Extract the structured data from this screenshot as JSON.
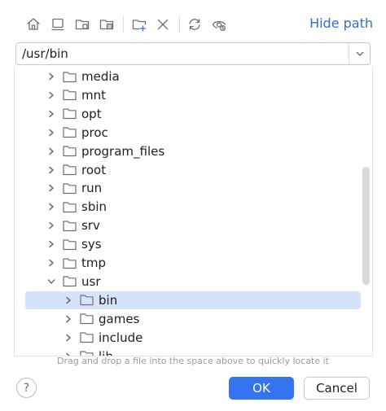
{
  "toolbar": {
    "buttons": [
      {
        "icon": "home-icon"
      },
      {
        "icon": "desktop-icon"
      },
      {
        "icon": "project-folder-icon"
      },
      {
        "icon": "module-folder-icon"
      },
      {
        "icon": "new-folder-icon"
      },
      {
        "icon": "delete-icon"
      },
      {
        "icon": "refresh-icon"
      },
      {
        "icon": "show-hidden-icon"
      }
    ],
    "hide_path_label": "Hide path"
  },
  "path": {
    "value": "/usr/bin"
  },
  "tree": {
    "items": [
      {
        "label": "media",
        "expanded": false,
        "selected": false,
        "level": 0
      },
      {
        "label": "mnt",
        "expanded": false,
        "selected": false,
        "level": 0
      },
      {
        "label": "opt",
        "expanded": false,
        "selected": false,
        "level": 0
      },
      {
        "label": "proc",
        "expanded": false,
        "selected": false,
        "level": 0
      },
      {
        "label": "program_files",
        "expanded": false,
        "selected": false,
        "level": 0
      },
      {
        "label": "root",
        "expanded": false,
        "selected": false,
        "level": 0
      },
      {
        "label": "run",
        "expanded": false,
        "selected": false,
        "level": 0
      },
      {
        "label": "sbin",
        "expanded": false,
        "selected": false,
        "level": 0
      },
      {
        "label": "srv",
        "expanded": false,
        "selected": false,
        "level": 0
      },
      {
        "label": "sys",
        "expanded": false,
        "selected": false,
        "level": 0
      },
      {
        "label": "tmp",
        "expanded": false,
        "selected": false,
        "level": 0
      },
      {
        "label": "usr",
        "expanded": true,
        "selected": false,
        "level": 0
      },
      {
        "label": "bin",
        "expanded": false,
        "selected": true,
        "level": 1
      },
      {
        "label": "games",
        "expanded": false,
        "selected": false,
        "level": 1
      },
      {
        "label": "include",
        "expanded": false,
        "selected": false,
        "level": 1
      },
      {
        "label": "lib",
        "expanded": false,
        "selected": false,
        "level": 1
      }
    ]
  },
  "hint": "Drag and drop a file into the space above to quickly locate it",
  "footer": {
    "help_label": "?",
    "ok_label": "OK",
    "cancel_label": "Cancel"
  },
  "colors": {
    "accent": "#3574f0",
    "link": "#2f6fd6",
    "selection": "#d5e3fb"
  }
}
